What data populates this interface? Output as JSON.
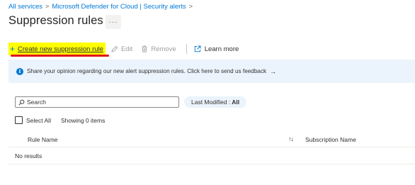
{
  "breadcrumb": {
    "items": [
      "All services",
      "Microsoft Defender for Cloud | Security alerts"
    ],
    "separator": ">"
  },
  "page": {
    "title": "Suppression rules",
    "more_label": "···"
  },
  "toolbar": {
    "create_label": "Create new suppression rule",
    "edit_label": "Edit",
    "remove_label": "Remove",
    "learn_more_label": "Learn more"
  },
  "banner": {
    "text": "Share your opinion regarding our new alert suppression rules. Click here to send us feedback",
    "arrow": "→"
  },
  "filters": {
    "search_placeholder": "Search",
    "pill_label": "Last Modified :",
    "pill_value": "All"
  },
  "list": {
    "select_all_label": "Select All",
    "showing_text": "Showing 0 items",
    "columns": [
      "Rule Name",
      "Subscription Name"
    ],
    "sort_glyph": "↑↓",
    "empty_text": "No results"
  },
  "colors": {
    "accent": "#0078d4",
    "highlight": "#ffff00",
    "annotation": "#e3151a",
    "banner_bg": "#ebf3fc"
  }
}
